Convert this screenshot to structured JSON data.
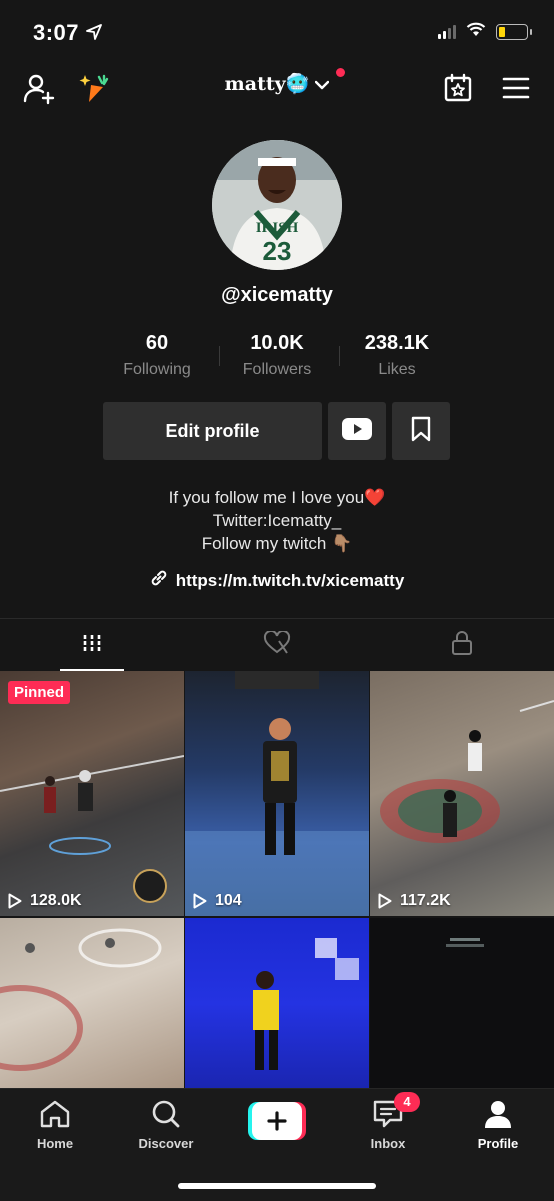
{
  "status_bar": {
    "time": "3:07"
  },
  "header": {
    "username": "matty🥶"
  },
  "profile": {
    "handle": "@xicematty",
    "stats": [
      {
        "value": "60",
        "label": "Following"
      },
      {
        "value": "10.0K",
        "label": "Followers"
      },
      {
        "value": "238.1K",
        "label": "Likes"
      }
    ],
    "edit_label": "Edit profile",
    "bio_lines": [
      "If you follow me I love you❤️",
      "Twitter:Icematty_",
      "Follow my twitch 👇🏽"
    ],
    "link": "https://m.twitch.tv/xicematty"
  },
  "videos": [
    {
      "views": "128.0K",
      "badge": "Pinned"
    },
    {
      "views": "104"
    },
    {
      "views": "117.2K"
    },
    {
      "views": ""
    },
    {
      "views": ""
    },
    {
      "views": ""
    }
  ],
  "bottom_nav": {
    "home": "Home",
    "discover": "Discover",
    "inbox": "Inbox",
    "inbox_badge": "4",
    "profile": "Profile"
  },
  "colors": {
    "accent": "#fe2c55",
    "background": "#161616",
    "button": "#2f2f2f"
  }
}
